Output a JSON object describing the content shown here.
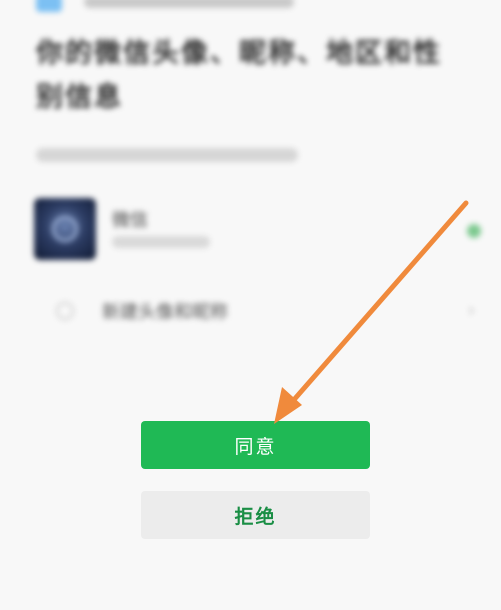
{
  "dialog": {
    "title": "你的微信头像、昵称、地区和性别信息",
    "account": {
      "name": "微信"
    },
    "option": {
      "label": "新建头像和昵称"
    }
  },
  "buttons": {
    "agree_label": "同意",
    "reject_label": "拒绝"
  },
  "colors": {
    "agree_bg": "#1fb955",
    "reject_text": "#1a8e45",
    "arrow": "#f08a3c"
  },
  "icons": {
    "avatar": "account-avatar-icon",
    "arrow": "arrow-annotation-icon"
  }
}
